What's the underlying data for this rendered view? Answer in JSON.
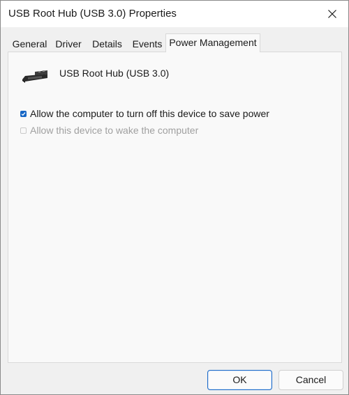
{
  "window": {
    "title": "USB Root Hub (USB 3.0) Properties",
    "close_icon": "close-icon"
  },
  "tabs": [
    {
      "label": "General",
      "active": false
    },
    {
      "label": "Driver",
      "active": false
    },
    {
      "label": "Details",
      "active": false
    },
    {
      "label": "Events",
      "active": false
    },
    {
      "label": "Power Management",
      "active": true
    }
  ],
  "device": {
    "icon": "usb-connector-icon",
    "name": "USB Root Hub (USB 3.0)"
  },
  "options": [
    {
      "label": "Allow the computer to turn off this device to save power",
      "checked": true,
      "enabled": true
    },
    {
      "label": "Allow this device to wake the computer",
      "checked": false,
      "enabled": false
    }
  ],
  "buttons": {
    "ok": "OK",
    "cancel": "Cancel"
  },
  "colors": {
    "accent": "#1666c5",
    "background": "#f0f0f0",
    "panel": "#f9f9f9"
  }
}
